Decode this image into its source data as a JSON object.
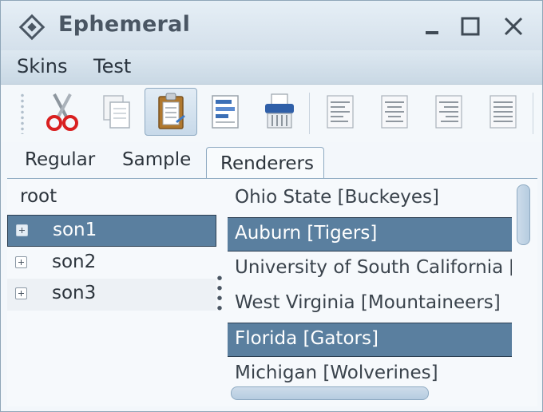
{
  "window": {
    "title": "Ephemeral",
    "app_icon": "diamond-logo-icon",
    "controls": [
      "minimize-icon",
      "maximize-icon",
      "close-icon"
    ]
  },
  "menu": {
    "items": [
      {
        "label": "Skins"
      },
      {
        "label": "Test"
      }
    ]
  },
  "toolbar": {
    "buttons": [
      {
        "icon": "cut-icon",
        "active": false
      },
      {
        "icon": "copy-icon",
        "active": false
      },
      {
        "icon": "paste-icon",
        "active": true
      },
      {
        "icon": "format-icon",
        "active": false
      },
      {
        "icon": "shredder-icon",
        "active": false
      },
      {
        "icon": "align-left-icon",
        "active": false
      },
      {
        "icon": "align-center-icon",
        "active": false
      },
      {
        "icon": "align-right-icon",
        "active": false
      },
      {
        "icon": "align-justify-icon",
        "active": false
      }
    ]
  },
  "tabs": {
    "items": [
      {
        "label": "Regular",
        "selected": false
      },
      {
        "label": "Sample",
        "selected": false
      },
      {
        "label": "Renderers",
        "selected": true
      }
    ]
  },
  "tree": {
    "root": "root",
    "children": [
      {
        "label": "son1",
        "selected": true
      },
      {
        "label": "son2",
        "selected": false
      },
      {
        "label": "son3",
        "selected": false
      }
    ]
  },
  "list": {
    "items": [
      {
        "label": "Ohio State [Buckeyes]",
        "selected": false
      },
      {
        "label": "Auburn [Tigers]",
        "selected": true
      },
      {
        "label": "University of South California [Trojans]",
        "selected": false
      },
      {
        "label": "West Virginia [Mountaineers]",
        "selected": false
      },
      {
        "label": "Florida [Gators]",
        "selected": true
      },
      {
        "label": "Michigan [Wolverines]",
        "selected": false
      }
    ]
  },
  "colors": {
    "selection": "#5a7f9f",
    "titlebar": "#d4e0eb",
    "accent_border": "#8eaac2"
  }
}
